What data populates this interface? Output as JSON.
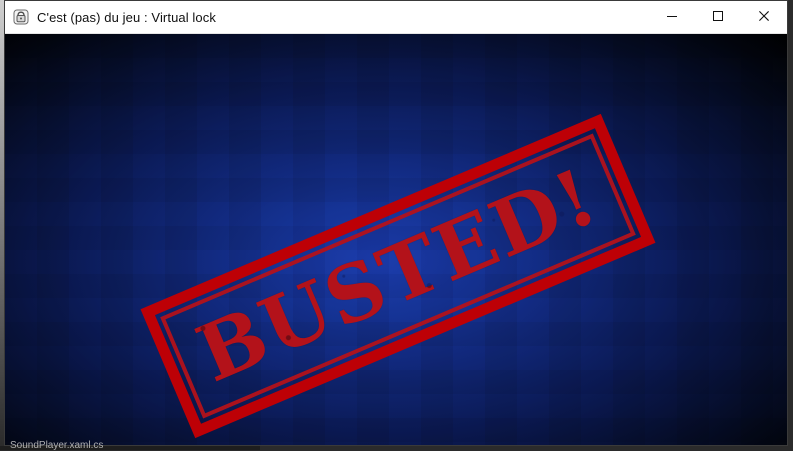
{
  "window": {
    "title": "C'est (pas) du jeu : Virtual lock",
    "controls": {
      "minimize_icon": "minimize-icon",
      "maximize_icon": "maximize-icon",
      "close_icon": "close-icon"
    }
  },
  "content": {
    "stamp_text": "BUSTED!",
    "background": {
      "accent_center": "#1a3aa8",
      "edge": "#000000"
    },
    "stamp_color": "#b3121a"
  },
  "behind_window": {
    "bottom_left_text": "SoundPlayer.xaml.cs"
  }
}
